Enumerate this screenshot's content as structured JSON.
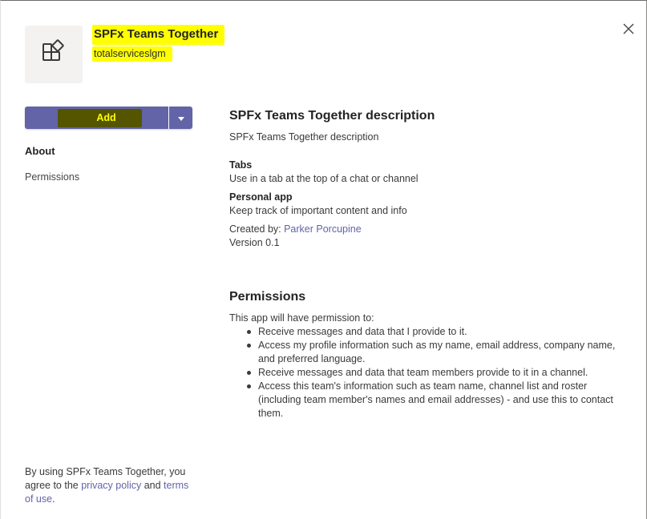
{
  "header": {
    "app_title": "SPFx Teams Together",
    "publisher": "totalserviceslgm"
  },
  "icons": {
    "app_icon": "app-grid-icon",
    "close": "close-icon",
    "dropdown": "chevron-down-icon"
  },
  "colors": {
    "accent": "#6264a7",
    "highlight": "#ffff00"
  },
  "actions": {
    "add_label": "Add"
  },
  "nav": {
    "about": "About",
    "permissions": "Permissions"
  },
  "about": {
    "heading": "SPFx Teams Together description",
    "description": "SPFx Teams Together description",
    "tabs_title": "Tabs",
    "tabs_text": "Use in a tab at the top of a chat or channel",
    "personal_title": "Personal app",
    "personal_text": "Keep track of important content and info",
    "created_by_label": "Created by: ",
    "created_by_name": "Parker Porcupine",
    "version": "Version 0.1"
  },
  "permissions": {
    "heading": "Permissions",
    "intro": "This app will have permission to:",
    "items": [
      "Receive messages and data that I provide to it.",
      "Access my profile information such as my name, email address, company name, and preferred language.",
      "Receive messages and data that team members provide to it in a channel.",
      "Access this team's information such as team name, channel list and roster (including team member's names and email addresses) - and use this to contact them."
    ]
  },
  "footer": {
    "prefix": "By using SPFx Teams Together, you agree to the ",
    "privacy_link": "privacy policy",
    "and": " and ",
    "terms_link": "terms of use",
    "suffix": "."
  }
}
